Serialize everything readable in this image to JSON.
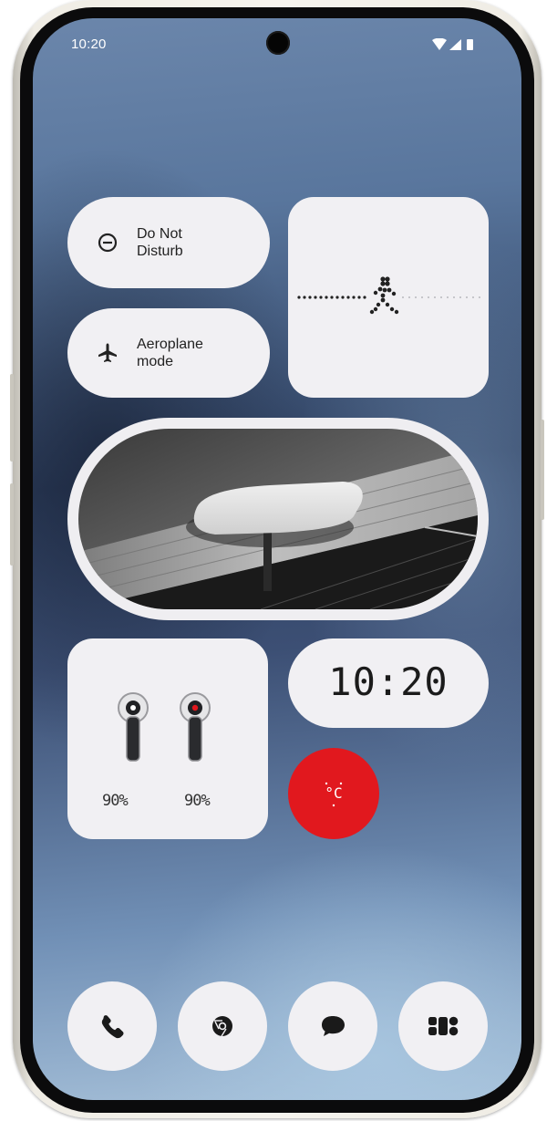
{
  "status_bar": {
    "time": "10:20"
  },
  "quick_tiles": [
    {
      "label_line1": "Do Not",
      "label_line2": "Disturb",
      "icon": "do-not-disturb-icon"
    },
    {
      "label_line1": "Aeroplane",
      "label_line2": "mode",
      "icon": "airplane-icon"
    }
  ],
  "widgets": {
    "steps": {
      "icon": "walking-person-icon"
    },
    "photo": {
      "description_icon": "photo-widget"
    },
    "earbuds": {
      "left_battery": "90%",
      "right_battery": "90%"
    },
    "clock": {
      "time": "10:20"
    },
    "weather": {
      "label": "°C"
    }
  },
  "dock": [
    {
      "icon": "phone-icon"
    },
    {
      "icon": "chrome-icon"
    },
    {
      "icon": "messages-icon"
    },
    {
      "icon": "app-drawer-icon"
    }
  ],
  "colors": {
    "tile_bg": "#f1f0f3",
    "accent_red": "#e1181e",
    "frame": "#f3f1eb"
  }
}
